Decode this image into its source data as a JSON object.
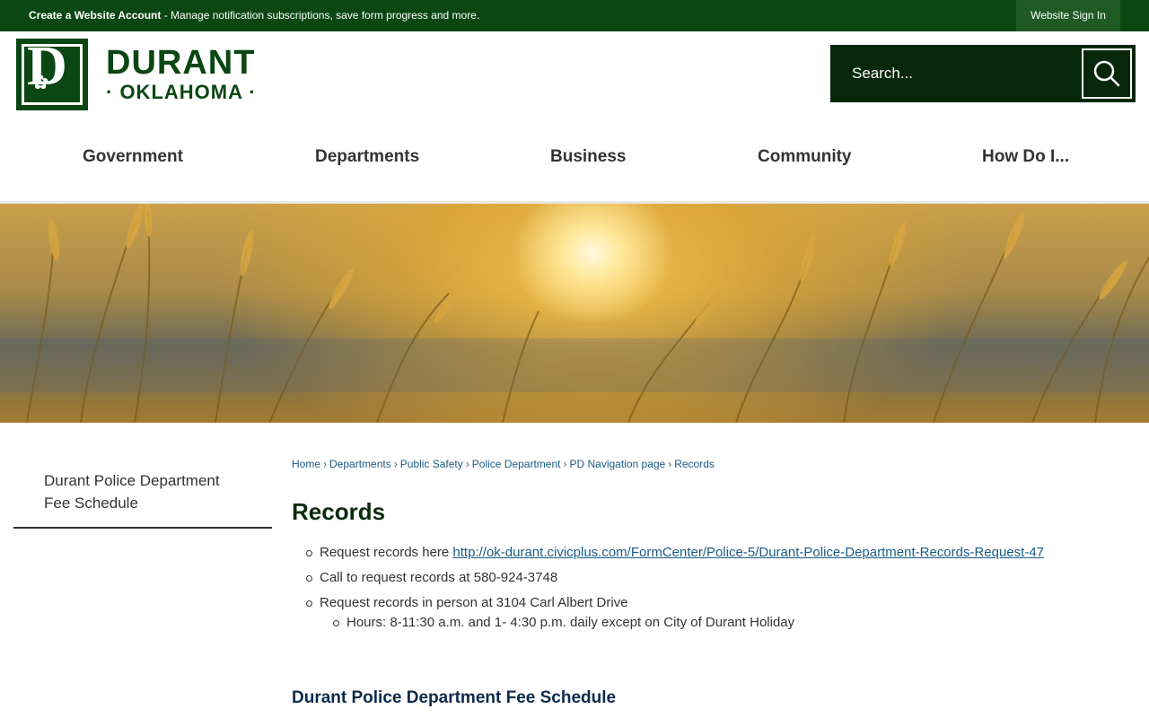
{
  "topbar": {
    "account_label": "Create a Website Account",
    "account_text": " - Manage notification subscriptions, save form progress and more.",
    "signin_label": "Website Sign In"
  },
  "logo": {
    "letter": "D",
    "name": "DURANT",
    "sub": "· OKLAHOMA ·"
  },
  "search": {
    "placeholder": "Search..."
  },
  "nav": {
    "items": [
      "Government",
      "Departments",
      "Business",
      "Community",
      "How Do I..."
    ]
  },
  "sidebar": {
    "link": "Durant Police Department Fee Schedule"
  },
  "breadcrumb": {
    "items": [
      "Home",
      "Departments",
      "Public Safety",
      "Police Department",
      "PD Navigation page",
      "Records"
    ],
    "separator": "›"
  },
  "page": {
    "title": "Records",
    "list": {
      "item1_text": "Request records here ",
      "item1_link": "http://ok-durant.civicplus.com/FormCenter/Police-5/Durant-Police-Department-Records-Request-47",
      "item2_text": "Call to request records at 580-924-3748",
      "item3_text": "Request records in person at 3104 Carl Albert Drive",
      "item3_sub": "Hours: 8-11:30 a.m. and 1- 4:30 p.m. daily except on City of Durant Holiday"
    },
    "section_title": "Durant Police Department Fee Schedule"
  },
  "colors": {
    "brand_green": "#0a4712",
    "search_bg": "#06270a",
    "link": "#1a5b85"
  }
}
